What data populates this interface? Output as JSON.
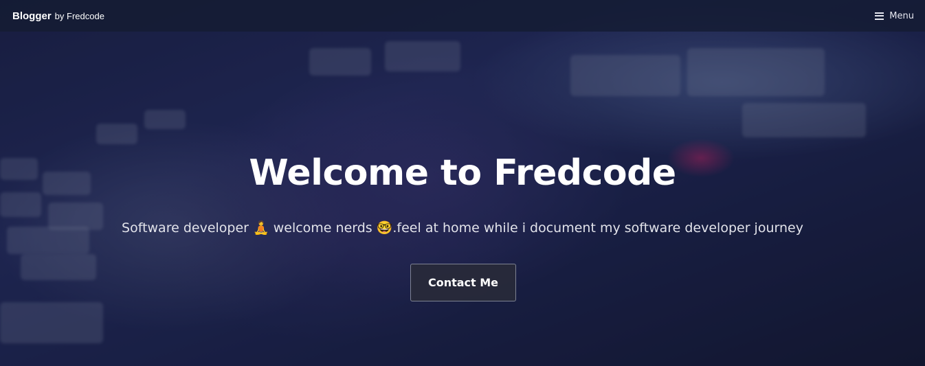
{
  "navbar": {
    "brand_name": "Blogger",
    "brand_suffix": "by Fredcode",
    "menu_label": "Menu",
    "menu_icon": "hamburger-icon"
  },
  "hero": {
    "title": "Welcome to Fredcode",
    "subtitle": "Software developer 🧘 welcome nerds 🤓.feel at home while i document my software developer journey",
    "cta_label": "Contact Me"
  },
  "colors": {
    "navbar_bg": "#141c32",
    "text": "#ffffff",
    "button_bg": "#282a3a"
  }
}
